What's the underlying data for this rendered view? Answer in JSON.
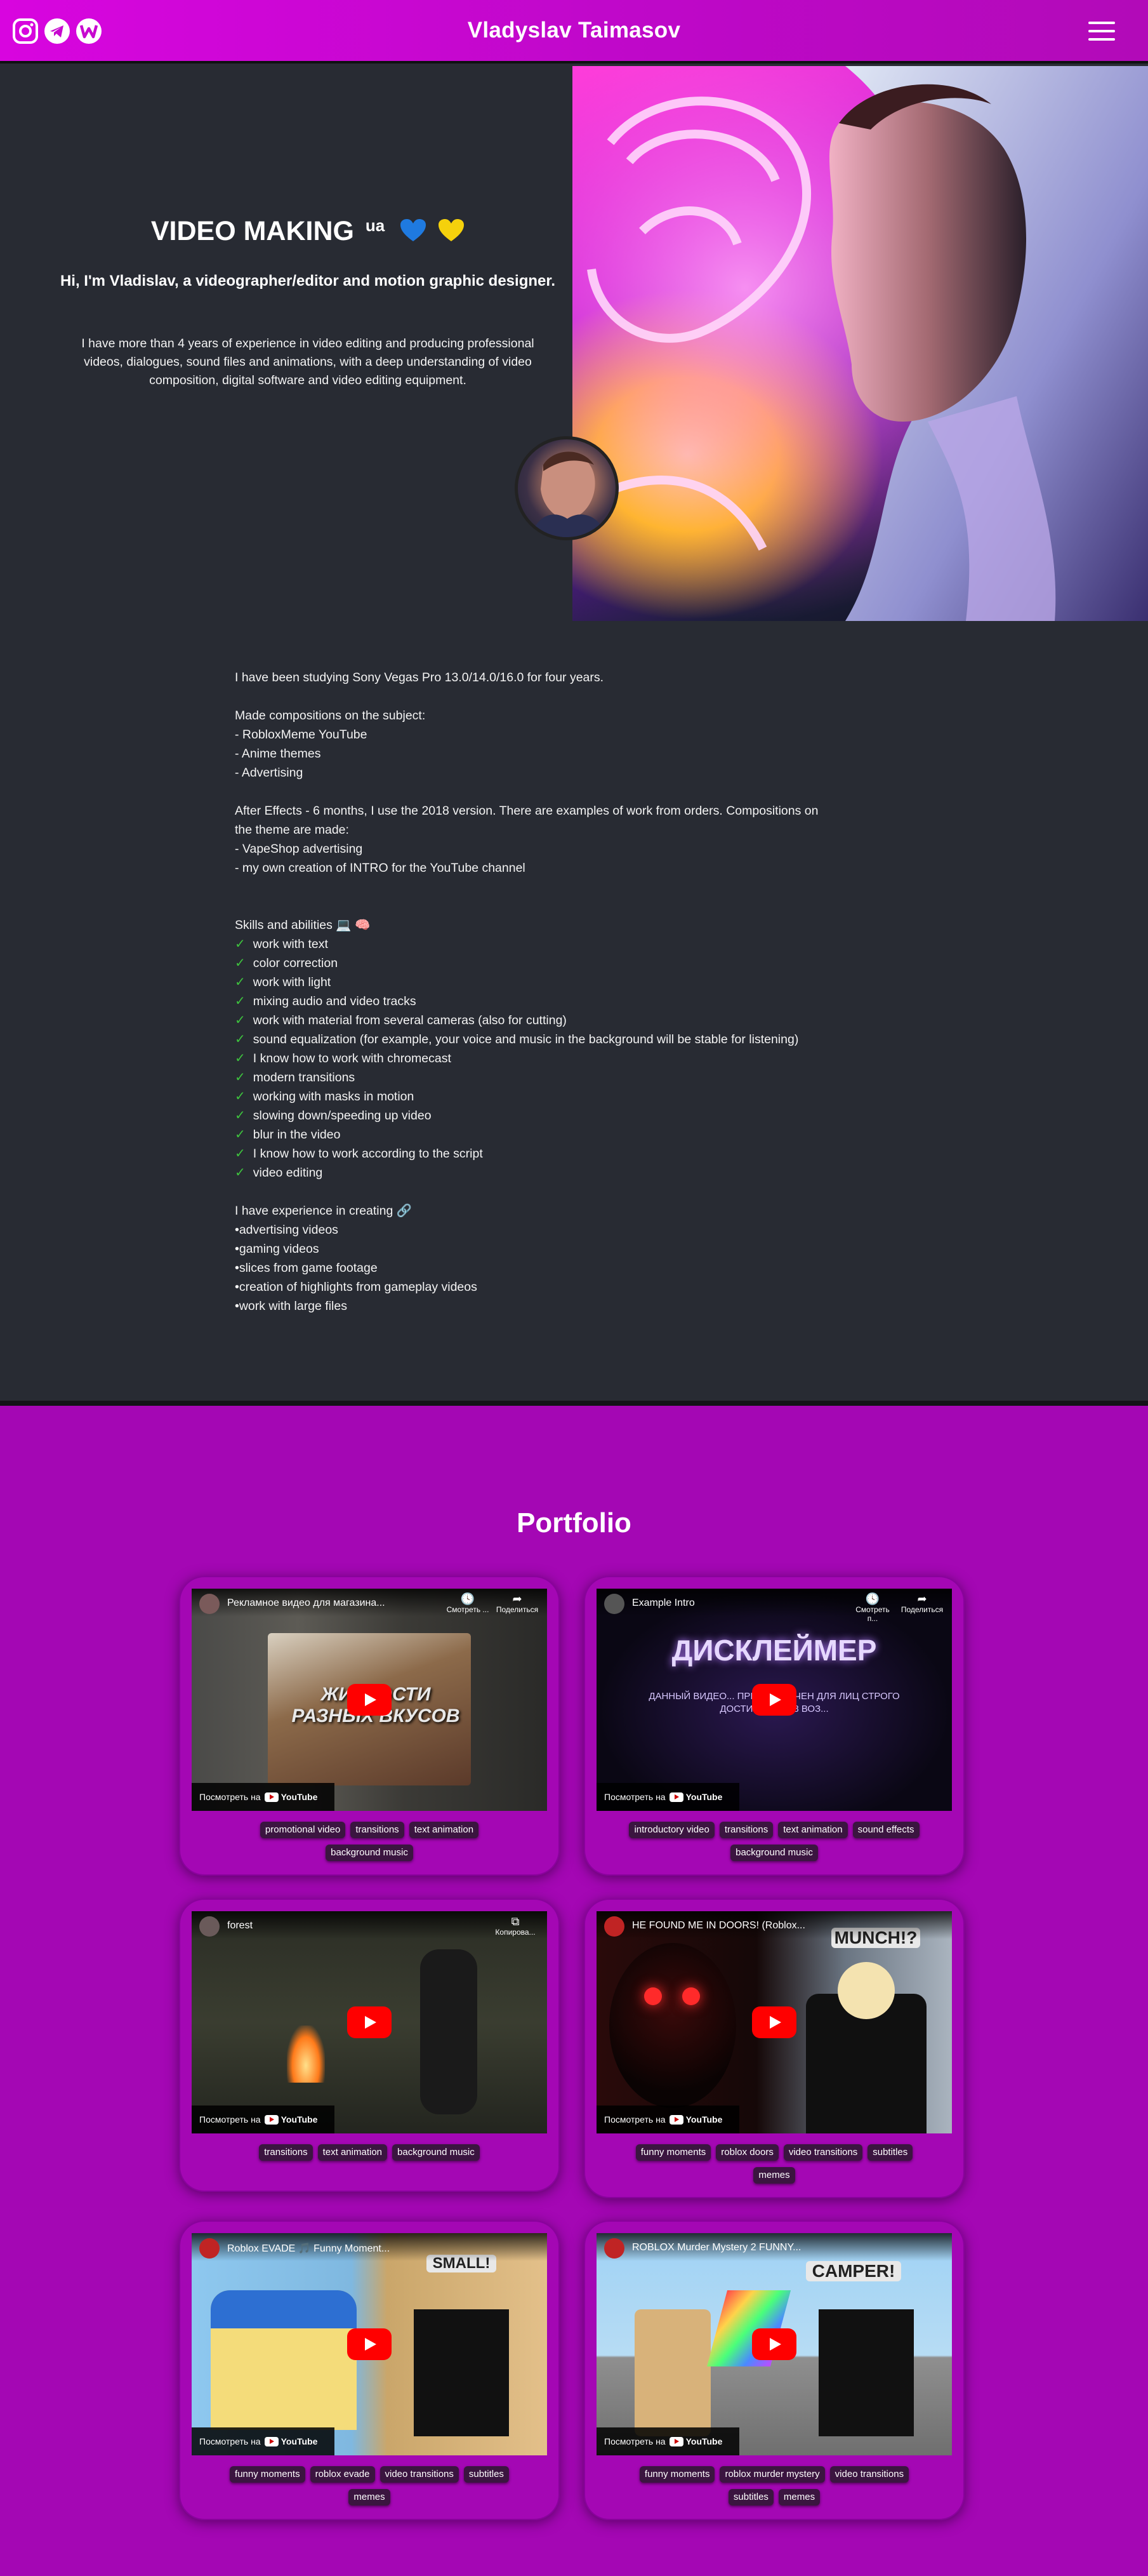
{
  "header": {
    "title": "Vladyslav Taimasov",
    "social": [
      {
        "icon": "instagram-icon"
      },
      {
        "icon": "telegram-icon"
      },
      {
        "icon": "workana-w-icon"
      }
    ],
    "menu_icon": "hamburger-menu-icon"
  },
  "hero": {
    "title": "VIDEO MAKING",
    "flag": "ua",
    "hearts": [
      "blue-heart",
      "yellow-heart"
    ],
    "subtitle": "Hi, I'm Vladislav, a videographer/editor and motion graphic designer.",
    "text": "I have more than 4 years of experience in video editing and producing professional videos, dialogues, sound files and animations, with a deep understanding of video composition, digital software and video editing equipment."
  },
  "about": {
    "lines": [
      "I have been studying Sony Vegas Pro 13.0/14.0/16.0 for four years.",
      "",
      "Made compositions on the subject:",
      "- RobloxMeme YouTube",
      "- Anime themes",
      "- Advertising",
      "",
      "After Effects - 6 months, I use the 2018 version. There are examples of work from orders. Compositions on",
      "the theme are made:",
      "- VapeShop advertising",
      "- my own creation of INTRO for the YouTube channel",
      "",
      "",
      "Skills and abilities 💻 🧠"
    ],
    "skills": [
      "work with text",
      "color correction",
      "work with light",
      "mixing audio and video tracks",
      "work with material from several cameras (also for cutting)",
      "sound equalization (for example, your voice and music in the background will be stable for listening)",
      "I know how to work with chromecast",
      "modern transitions",
      "working with masks in motion",
      "slowing down/speeding up video",
      "blur in the video",
      "I know how to work according to the script",
      "video editing"
    ],
    "experience_title": "I have experience in creating 🔗",
    "experience": [
      "•advertising videos",
      "•gaming videos",
      "•slices from game footage",
      "•creation of highlights from gameplay videos",
      "•work with large files"
    ]
  },
  "portfolio": {
    "title": "Portfolio",
    "watch_on": "Посмотреть на",
    "youtube": "YouTube",
    "cards": [
      {
        "video_title": "Рекламное видео для магазина...",
        "ctrl1": "Смотреть ...",
        "ctrl2": "Поделиться",
        "overlay": "ЖИДКОСТИ РАЗНЫХ ВКУСОВ",
        "tags": [
          "promotional video",
          "transitions",
          "text animation",
          "background music"
        ]
      },
      {
        "video_title": "Example Intro",
        "ctrl1": "Смотреть п...",
        "ctrl2": "Поделиться",
        "overlay": "ДИСКЛЕЙМЕР",
        "overlay2": "ДАННЫЙ ВИДЕО... ПРЕДНАЗНАЧЕН ДЛЯ ЛИЦ СТРОГО ДОСТИГШИХ +18 ВОЗ...",
        "tags": [
          "introductory video",
          "transitions",
          "text animation",
          "sound effects",
          "background music"
        ]
      },
      {
        "video_title": "forest",
        "ctrl1": "Копирова...",
        "ctrl2": "",
        "overlay": "",
        "tags": [
          "transitions",
          "text animation",
          "background music"
        ]
      },
      {
        "video_title": "HE FOUND ME IN DOORS! (Roblox...",
        "ctrl1": "",
        "ctrl2": "",
        "overlay": "MUNCH!?",
        "tags": [
          "funny moments",
          "roblox doors",
          "video transitions",
          "subtitles",
          "memes"
        ]
      },
      {
        "video_title": "Roblox EVADE 🎵 Funny Moment...",
        "ctrl1": "",
        "ctrl2": "",
        "overlay": "SMALL!",
        "tags": [
          "funny moments",
          "roblox evade",
          "video transitions",
          "subtitles",
          "memes"
        ]
      },
      {
        "video_title": "ROBLOX Murder Mystery 2 FUNNY...",
        "ctrl1": "",
        "ctrl2": "",
        "overlay": "CAMPER!",
        "tags": [
          "funny moments",
          "roblox murder mystery",
          "video transitions",
          "subtitles",
          "memes"
        ]
      }
    ]
  },
  "colors": {
    "header_gradient_start": "#d805df",
    "header_gradient_end": "#b20ab8",
    "page_bg": "#282b33",
    "portfolio_bg": "#a407b4",
    "youtube_red": "#ff0000",
    "check_green": "#3ec33e"
  }
}
